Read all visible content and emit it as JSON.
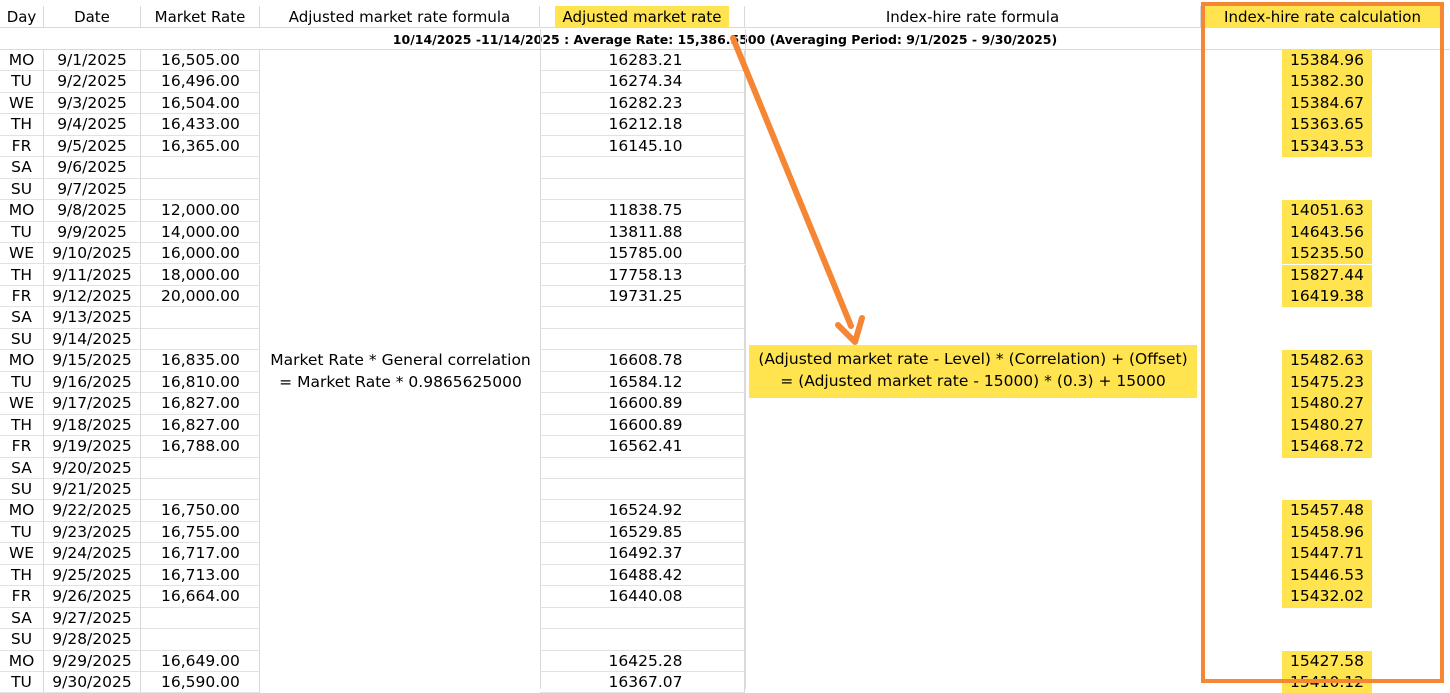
{
  "headers": {
    "day": "Day",
    "date": "Date",
    "market_rate": "Market Rate",
    "adj_formula": "Adjusted market rate formula",
    "adj_rate": "Adjusted market rate",
    "index_formula": "Index-hire rate formula",
    "index_calc": "Index-hire rate calculation"
  },
  "banner": "10/14/2025 -11/14/2025 : Average Rate: 15,386.5500 (Averaging Period: 9/1/2025 - 9/30/2025)",
  "adj_formula_text": {
    "line1": "Market Rate * General correlation",
    "line2": "= Market Rate * 0.9865625000"
  },
  "index_formula_text": {
    "line1": "(Adjusted market rate - Level) * (Correlation) + (Offset)",
    "line2": "= (Adjusted market rate - 15000) * (0.3) + 15000"
  },
  "colors": {
    "highlight": "#ffe34f",
    "annotation": "#f58634"
  },
  "rows": [
    {
      "day": "MO",
      "date": "9/1/2025",
      "rate": "16,505.00",
      "adj": "16283.21",
      "idx": "15384.96"
    },
    {
      "day": "TU",
      "date": "9/2/2025",
      "rate": "16,496.00",
      "adj": "16274.34",
      "idx": "15382.30"
    },
    {
      "day": "WE",
      "date": "9/3/2025",
      "rate": "16,504.00",
      "adj": "16282.23",
      "idx": "15384.67"
    },
    {
      "day": "TH",
      "date": "9/4/2025",
      "rate": "16,433.00",
      "adj": "16212.18",
      "idx": "15363.65"
    },
    {
      "day": "FR",
      "date": "9/5/2025",
      "rate": "16,365.00",
      "adj": "16145.10",
      "idx": "15343.53"
    },
    {
      "day": "SA",
      "date": "9/6/2025",
      "rate": "",
      "adj": "",
      "idx": ""
    },
    {
      "day": "SU",
      "date": "9/7/2025",
      "rate": "",
      "adj": "",
      "idx": ""
    },
    {
      "day": "MO",
      "date": "9/8/2025",
      "rate": "12,000.00",
      "adj": "11838.75",
      "idx": "14051.63"
    },
    {
      "day": "TU",
      "date": "9/9/2025",
      "rate": "14,000.00",
      "adj": "13811.88",
      "idx": "14643.56"
    },
    {
      "day": "WE",
      "date": "9/10/2025",
      "rate": "16,000.00",
      "adj": "15785.00",
      "idx": "15235.50"
    },
    {
      "day": "TH",
      "date": "9/11/2025",
      "rate": "18,000.00",
      "adj": "17758.13",
      "idx": "15827.44"
    },
    {
      "day": "FR",
      "date": "9/12/2025",
      "rate": "20,000.00",
      "adj": "19731.25",
      "idx": "16419.38"
    },
    {
      "day": "SA",
      "date": "9/13/2025",
      "rate": "",
      "adj": "",
      "idx": ""
    },
    {
      "day": "SU",
      "date": "9/14/2025",
      "rate": "",
      "adj": "",
      "idx": ""
    },
    {
      "day": "MO",
      "date": "9/15/2025",
      "rate": "16,835.00",
      "adj": "16608.78",
      "idx": "15482.63"
    },
    {
      "day": "TU",
      "date": "9/16/2025",
      "rate": "16,810.00",
      "adj": "16584.12",
      "idx": "15475.23"
    },
    {
      "day": "WE",
      "date": "9/17/2025",
      "rate": "16,827.00",
      "adj": "16600.89",
      "idx": "15480.27"
    },
    {
      "day": "TH",
      "date": "9/18/2025",
      "rate": "16,827.00",
      "adj": "16600.89",
      "idx": "15480.27"
    },
    {
      "day": "FR",
      "date": "9/19/2025",
      "rate": "16,788.00",
      "adj": "16562.41",
      "idx": "15468.72"
    },
    {
      "day": "SA",
      "date": "9/20/2025",
      "rate": "",
      "adj": "",
      "idx": ""
    },
    {
      "day": "SU",
      "date": "9/21/2025",
      "rate": "",
      "adj": "",
      "idx": ""
    },
    {
      "day": "MO",
      "date": "9/22/2025",
      "rate": "16,750.00",
      "adj": "16524.92",
      "idx": "15457.48"
    },
    {
      "day": "TU",
      "date": "9/23/2025",
      "rate": "16,755.00",
      "adj": "16529.85",
      "idx": "15458.96"
    },
    {
      "day": "WE",
      "date": "9/24/2025",
      "rate": "16,717.00",
      "adj": "16492.37",
      "idx": "15447.71"
    },
    {
      "day": "TH",
      "date": "9/25/2025",
      "rate": "16,713.00",
      "adj": "16488.42",
      "idx": "15446.53"
    },
    {
      "day": "FR",
      "date": "9/26/2025",
      "rate": "16,664.00",
      "adj": "16440.08",
      "idx": "15432.02"
    },
    {
      "day": "SA",
      "date": "9/27/2025",
      "rate": "",
      "adj": "",
      "idx": ""
    },
    {
      "day": "SU",
      "date": "9/28/2025",
      "rate": "",
      "adj": "",
      "idx": ""
    },
    {
      "day": "MO",
      "date": "9/29/2025",
      "rate": "16,649.00",
      "adj": "16425.28",
      "idx": "15427.58"
    },
    {
      "day": "TU",
      "date": "9/30/2025",
      "rate": "16,590.00",
      "adj": "16367.07",
      "idx": "15410.12"
    }
  ]
}
